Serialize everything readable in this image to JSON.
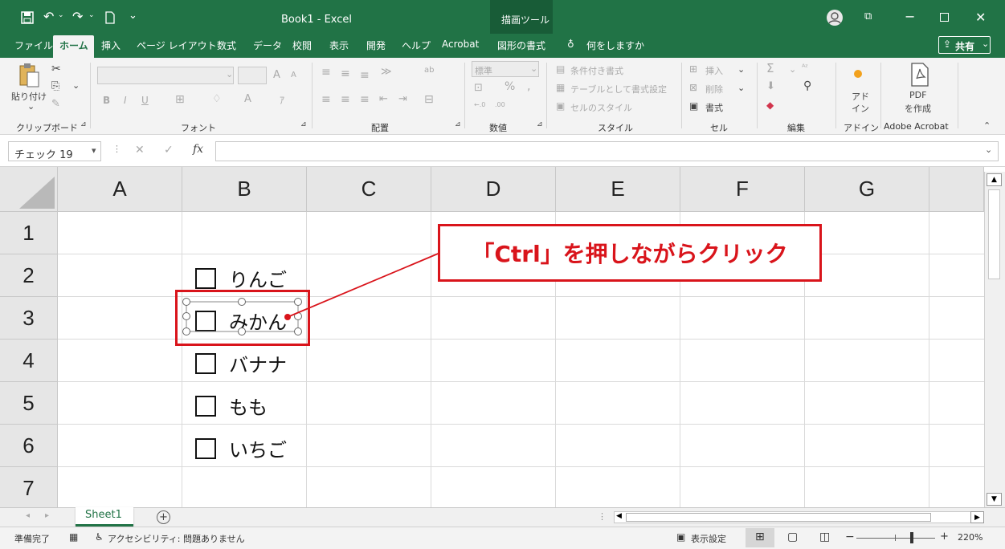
{
  "titlebar": {
    "title": "Book1 - Excel",
    "context_tab": "描画ツール",
    "restore_label": "⧉"
  },
  "tabs": {
    "file": "ファイル",
    "home": "ホーム",
    "insert": "挿入",
    "page_layout": "ページ レイアウト",
    "formulas": "数式",
    "data": "データ",
    "review": "校閲",
    "view": "表示",
    "developer": "開発",
    "help": "ヘルプ",
    "acrobat": "Acrobat",
    "shape_format": "図形の書式",
    "tell_me": "何をしますか",
    "share": "共有"
  },
  "ribbon": {
    "clipboard": {
      "paste": "貼り付け",
      "group": "クリップボード"
    },
    "font": {
      "group": "フォント",
      "bold": "B",
      "italic": "I",
      "underline": "U",
      "grow": "A",
      "shrink": "A"
    },
    "alignment": {
      "group": "配置"
    },
    "number": {
      "format": "標準",
      "percent": "%",
      "comma": ",",
      "group": "数値"
    },
    "styles": {
      "conditional": "条件付き書式",
      "table": "テーブルとして書式設定",
      "cell_styles": "セルのスタイル",
      "group": "スタイル"
    },
    "cells": {
      "insert": "挿入",
      "delete": "削除",
      "format": "書式",
      "group": "セル"
    },
    "editing": {
      "group": "編集",
      "sum": "Σ"
    },
    "addins": {
      "label_1": "アド",
      "label_2": "イン",
      "group": "アドイン"
    },
    "adobe": {
      "pdf": "PDF",
      "create": "を作成",
      "group": "Adobe Acrobat"
    }
  },
  "formula_bar": {
    "name_box": "チェック 19",
    "fx": "fx",
    "cancel": "✕",
    "enter": "✓"
  },
  "columns": [
    "A",
    "B",
    "C",
    "D",
    "E",
    "F",
    "G"
  ],
  "rows": [
    "1",
    "2",
    "3",
    "4",
    "5",
    "6",
    "7"
  ],
  "checkboxes": [
    "りんご",
    "みかん",
    "バナナ",
    "もも",
    "いちご"
  ],
  "callout": {
    "text": "「Ctrl」を押しながらクリック",
    "color": "#d9141b"
  },
  "sheets": {
    "active": "Sheet1",
    "add": "+"
  },
  "status": {
    "ready": "準備完了",
    "accessibility": "アクセシビリティ: 問題ありません",
    "display_settings": "表示設定",
    "zoom": "220%",
    "zoom_minus": "−",
    "zoom_plus": "+"
  },
  "colors": {
    "excel_green": "#217346",
    "accent_red": "#d9141b"
  }
}
